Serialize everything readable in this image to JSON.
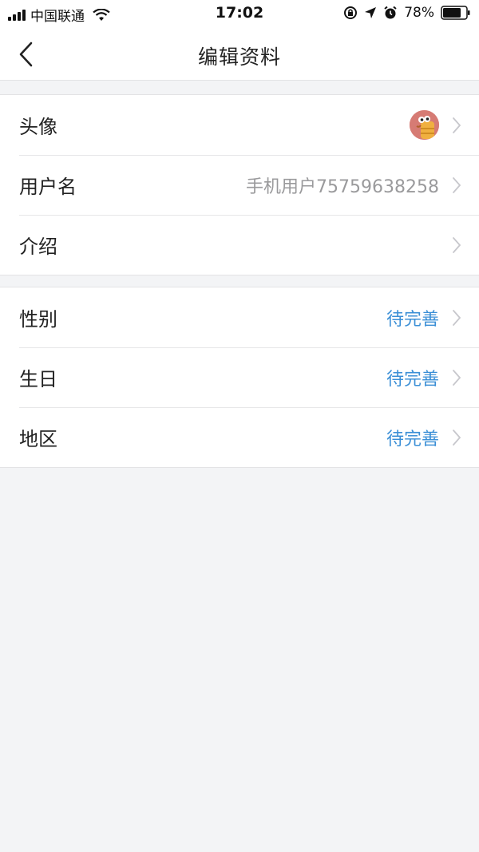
{
  "status_bar": {
    "carrier": "中国联通",
    "time": "17:02",
    "battery": "78%"
  },
  "nav": {
    "title": "编辑资料"
  },
  "groups": [
    {
      "rows": [
        {
          "label": "头像"
        },
        {
          "label": "用户名",
          "value": "手机用户75759638258"
        },
        {
          "label": "介绍",
          "value": ""
        }
      ]
    },
    {
      "rows": [
        {
          "label": "性别",
          "value": "待完善"
        },
        {
          "label": "生日",
          "value": "待完善"
        },
        {
          "label": "地区",
          "value": "待完善"
        }
      ]
    }
  ],
  "colors": {
    "pending": "#3b8fd6",
    "background": "#f3f4f6",
    "avatar": "#d67b74"
  }
}
